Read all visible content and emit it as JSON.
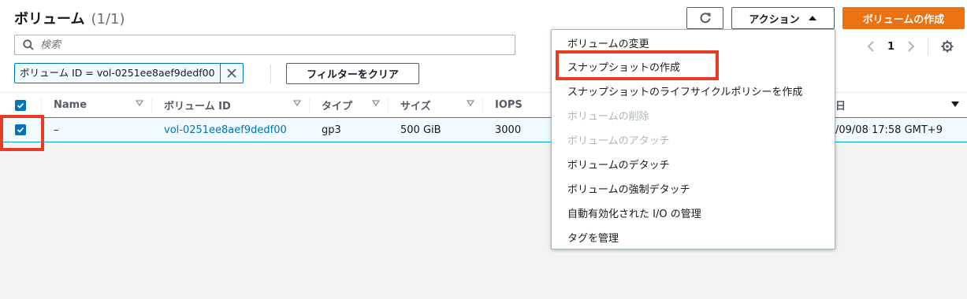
{
  "header": {
    "title": "ボリューム",
    "count": "(1/1)",
    "actions_label": "アクション",
    "create_label": "ボリュームの作成"
  },
  "search": {
    "placeholder": "検索"
  },
  "filter": {
    "token": "ボリューム ID = vol-0251ee8aef9dedf00",
    "clear_label": "フィルターをクリア"
  },
  "pagination": {
    "page": "1"
  },
  "table": {
    "columns": [
      "Name",
      "ボリューム ID",
      "タイプ",
      "サイズ",
      "IOPS"
    ],
    "partial_column_tail": "日",
    "rows": [
      {
        "selected": true,
        "name": "–",
        "volume_id": "vol-0251ee8aef9dedf00",
        "type": "gp3",
        "size": "500 GiB",
        "iops": "3000",
        "created": "/09/08 17:58 GMT+9"
      }
    ]
  },
  "actions_menu": {
    "items": [
      {
        "label": "ボリュームの変更",
        "disabled": false
      },
      {
        "label": "スナップショットの作成",
        "disabled": false,
        "highlighted": true
      },
      {
        "label": "スナップショットのライフサイクルポリシーを作成",
        "disabled": false
      },
      {
        "label": "ボリュームの削除",
        "disabled": true
      },
      {
        "label": "ボリュームのアタッチ",
        "disabled": true
      },
      {
        "label": "ボリュームのデタッチ",
        "disabled": false
      },
      {
        "label": "ボリュームの強制デタッチ",
        "disabled": false
      },
      {
        "label": "自動有効化された I/O の管理",
        "disabled": false
      },
      {
        "label": "タグを管理",
        "disabled": false
      }
    ]
  },
  "colors": {
    "accent": "#0073bb",
    "primary_button": "#ec7211",
    "highlight": "#e63c25",
    "disabled_text": "#aab7b8"
  },
  "icons": {
    "refresh": "refresh-icon",
    "caret": "caret-up-icon",
    "search": "search-icon",
    "close": "close-icon",
    "settings": "gear-icon"
  }
}
